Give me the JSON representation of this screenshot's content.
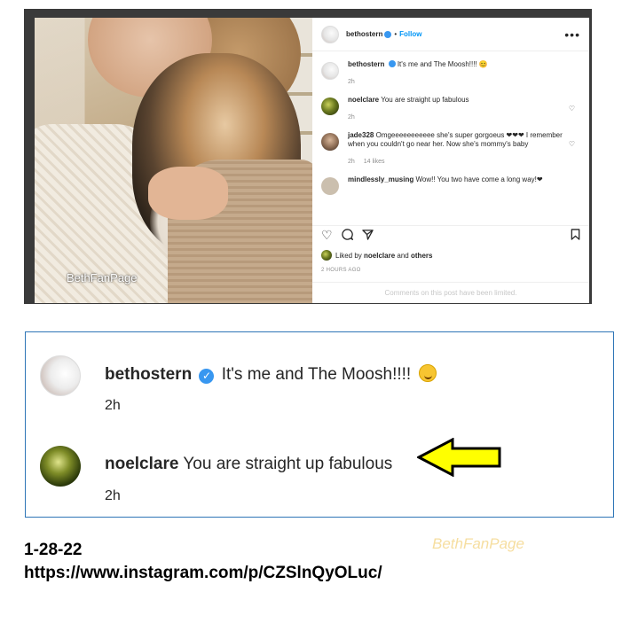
{
  "screenshot": {
    "photo_watermark": "BethFanPage",
    "header": {
      "username": "bethostern",
      "follow_label": "Follow",
      "separator": "•",
      "more": "•••"
    },
    "comments": [
      {
        "user": "bethostern",
        "text": "It's me and The Moosh!!!! 😊",
        "time": "2h"
      },
      {
        "user": "noelclare",
        "text": "You are straight up fabulous",
        "time": "2h"
      },
      {
        "user": "jade328",
        "text": "Omgeeeeeeeeeee she's super gorgoeus ❤❤❤ I remember when you couldn't go near her. Now she's mommy's baby",
        "time": "2h",
        "likes": "14 likes"
      },
      {
        "user": "mindlessly_musing",
        "text": "Wow!! You two have come a long way!❤"
      }
    ],
    "liked_by_prefix": "Liked by",
    "liked_by_user": "noelclare",
    "liked_by_suffix": "and",
    "liked_by_others": "others",
    "posted_ago": "2 HOURS AGO",
    "comments_limited": "Comments on this post have been limited."
  },
  "zoom": {
    "comments": [
      {
        "user": "bethostern",
        "text": "It's me and The Moosh!!!!",
        "time": "2h"
      },
      {
        "user": "noelclare",
        "text": "You are straight up fabulous",
        "time": "2h"
      }
    ]
  },
  "footer": {
    "date": "1-28-22",
    "url": "https://www.instagram.com/p/CZSlnQyOLuc/",
    "watermark": "BethFanPage"
  },
  "colors": {
    "border": "#2e75b6",
    "arrow_fill": "#ffff00",
    "verified": "#3897f0",
    "follow": "#0095f6"
  },
  "icons": [
    "heart-icon",
    "comment-icon",
    "share-icon",
    "bookmark-icon",
    "more-icon",
    "verified-icon",
    "arrow-icon"
  ]
}
